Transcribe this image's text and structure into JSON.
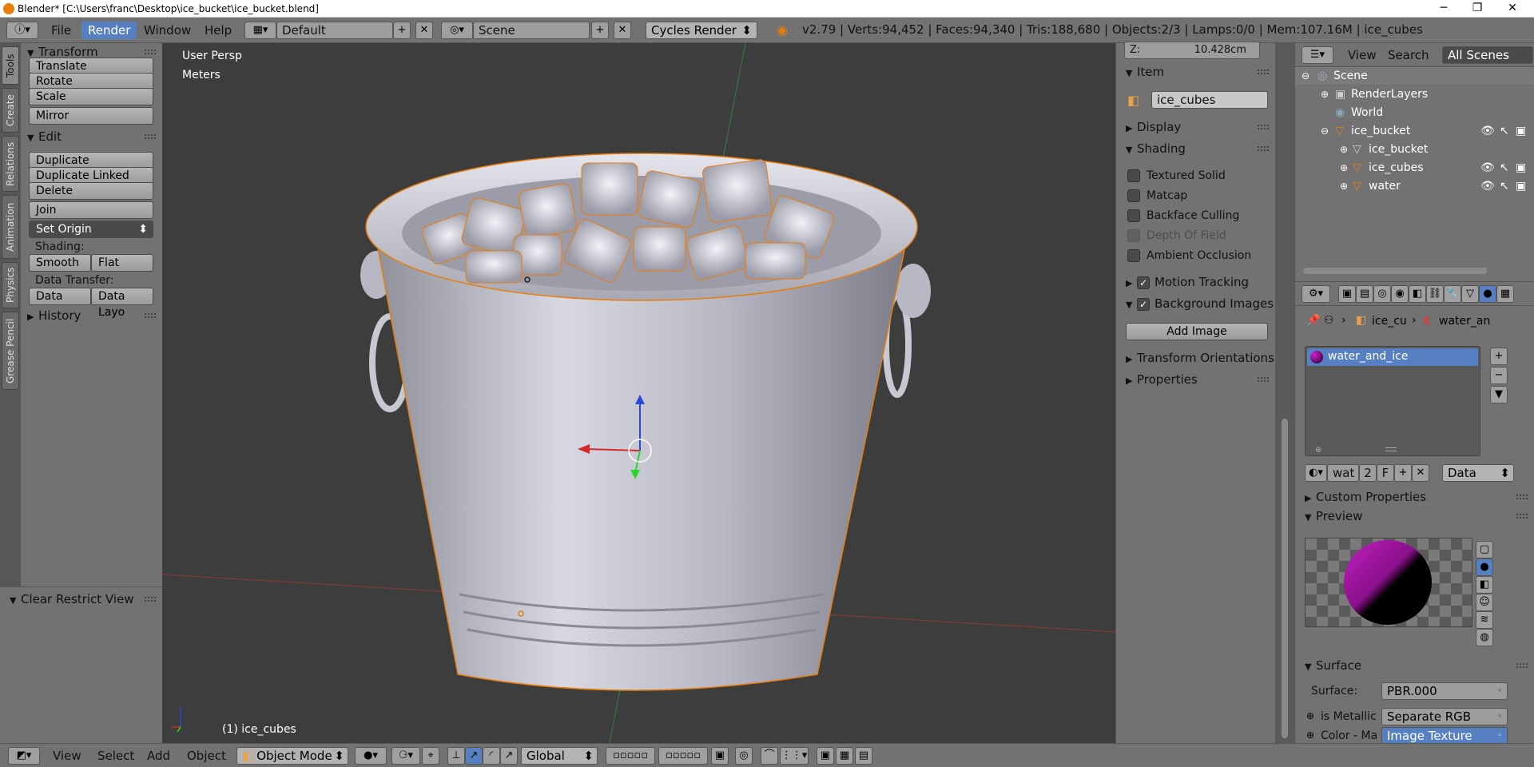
{
  "window": {
    "title": "Blender* [C:\\Users\\franc\\Desktop\\ice_bucket\\ice_bucket.blend]"
  },
  "topbar": {
    "menus": [
      "File",
      "Render",
      "Window",
      "Help"
    ],
    "screen_layout": "Default",
    "scene": "Scene",
    "render_engine": "Cycles Render",
    "stats": "v2.79 | Verts:94,452 | Faces:94,340 | Tris:188,680 | Objects:2/3 | Lamps:0/0 | Mem:107.16M | ice_cubes"
  },
  "vtabs": [
    "Tools",
    "Create",
    "Relations",
    "Animation",
    "Physics",
    "Grease Pencil"
  ],
  "toolshelf": {
    "transform_header": "Transform",
    "translate": "Translate",
    "rotate": "Rotate",
    "scale": "Scale",
    "mirror": "Mirror",
    "edit_header": "Edit",
    "duplicate": "Duplicate",
    "duplicate_linked": "Duplicate Linked",
    "delete": "Delete",
    "join": "Join",
    "set_origin": "Set Origin",
    "shading_label": "Shading:",
    "smooth": "Smooth",
    "flat": "Flat",
    "data_transfer_label": "Data Transfer:",
    "data": "Data",
    "data_layout": "Data Layo",
    "history_header": "History",
    "clear_restrict_view": "Clear Restrict View"
  },
  "viewport": {
    "view_name": "User Persp",
    "units": "Meters",
    "active_object": "(1) ice_cubes"
  },
  "npanel": {
    "z_label": "Z:",
    "z_value": "10.428cm",
    "item_header": "Item",
    "object_name": "ice_cubes",
    "display_header": "Display",
    "shading_header": "Shading",
    "textured_solid": "Textured Solid",
    "matcap": "Matcap",
    "backface_culling": "Backface Culling",
    "depth_of_field": "Depth Of Field",
    "ambient_occlusion": "Ambient Occlusion",
    "motion_tracking": "Motion Tracking",
    "background_images": "Background Images",
    "add_image": "Add Image",
    "transform_orientations": "Transform Orientations",
    "properties": "Properties"
  },
  "outliner": {
    "view_menu": "View",
    "search_menu": "Search",
    "filter": "All Scenes",
    "rows": [
      {
        "label": "Scene",
        "depth": 0
      },
      {
        "label": "RenderLayers",
        "depth": 1
      },
      {
        "label": "World",
        "depth": 1
      },
      {
        "label": "ice_bucket",
        "depth": 1
      },
      {
        "label": "ice_bucket",
        "depth": 2
      },
      {
        "label": "ice_cubes",
        "depth": 2
      },
      {
        "label": "water",
        "depth": 2
      }
    ]
  },
  "props": {
    "breadcrumb_object": "ice_cu",
    "breadcrumb_material": "water_an",
    "material_slot": "water_and_ice",
    "material_name": "wat",
    "users": "2",
    "fake_user": "F",
    "link": "Data",
    "custom_properties": "Custom Properties",
    "preview": "Preview",
    "surface_header": "Surface",
    "surface_label": "Surface:",
    "surface_value": "PBR.000",
    "is_metallic_label": "is Metallic",
    "is_metallic_value": "Separate RGB",
    "color_label": "Color - Ma",
    "color_value": "Image Texture"
  },
  "bottombar": {
    "menus": [
      "View",
      "Select",
      "Add",
      "Object"
    ],
    "mode": "Object Mode",
    "orientation": "Global"
  },
  "colors": {
    "accent": "#5680c2",
    "panel": "#727272",
    "viewport_bg": "#3d3d3d",
    "selection_outline": "#e87d0d"
  }
}
